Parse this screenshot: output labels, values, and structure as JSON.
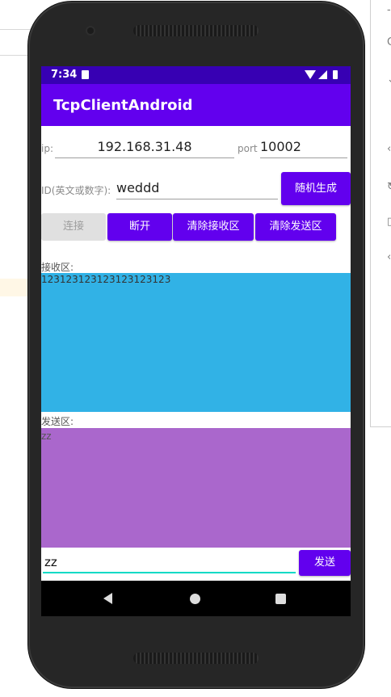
{
  "status": {
    "time": "7:34"
  },
  "app": {
    "title": "TcpClientAndroid"
  },
  "connection": {
    "ip_label": "ip:",
    "ip_value": "192.168.31.48",
    "port_label": "port",
    "port_value": "10002",
    "id_label": "ID(英文或数字):",
    "id_value": "weddd",
    "random_button": "随机生成"
  },
  "buttons": {
    "connect": "连接",
    "disconnect": "断开",
    "clear_receive": "清除接收区",
    "clear_send": "清除发送区",
    "send": "发送"
  },
  "receive": {
    "label": "接收区:",
    "content": "123123123123123123123"
  },
  "send_area": {
    "label": "发送区:",
    "content": "zz"
  },
  "input": {
    "value": "zz"
  },
  "colors": {
    "status_bar": "#3700b3",
    "app_bar": "#6200ee",
    "receive_bg": "#31b2e6",
    "send_bg": "#aa67cc",
    "input_underline": "#03dac5"
  }
}
